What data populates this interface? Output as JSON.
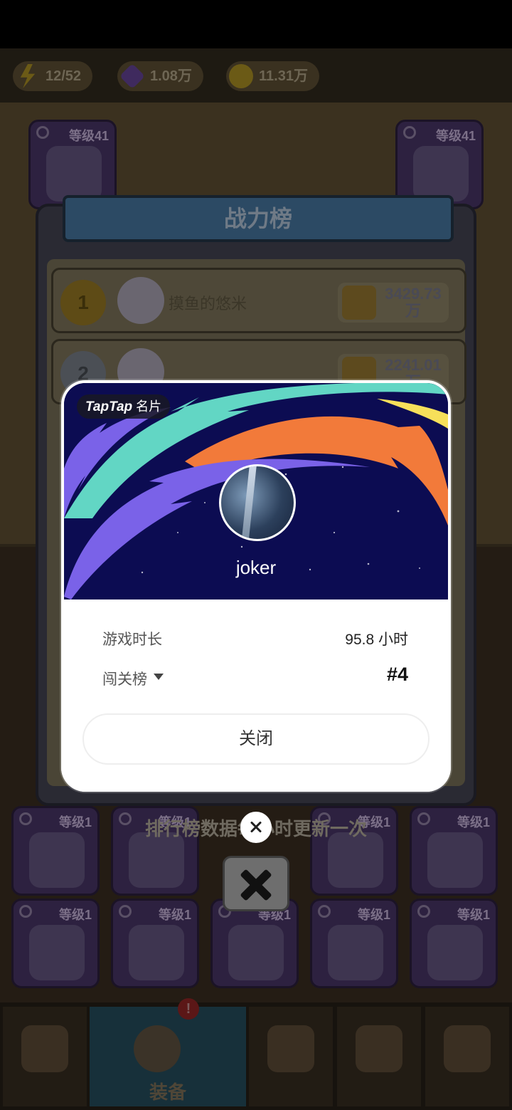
{
  "resources": [
    {
      "icon": "energy-icon",
      "value": "12/52"
    },
    {
      "icon": "gem-icon",
      "value": "1.08万"
    },
    {
      "icon": "coin-icon",
      "value": "11.31万"
    }
  ],
  "equipment_slots": {
    "level_label": "等级41"
  },
  "bottom_slots": {
    "level_label": "等级1"
  },
  "leaderboard": {
    "title": "战力榜",
    "rows": [
      {
        "rank": "1",
        "name": "摸鱼的悠米",
        "power": "3429.73万"
      },
      {
        "rank": "2",
        "name": "",
        "power": "2241.01万"
      }
    ],
    "notice": "排行榜数据每小时更新一次"
  },
  "nav": {
    "tabs": [
      {
        "icon": "shop-icon",
        "label": ""
      },
      {
        "icon": "character-icon",
        "label": "装备",
        "badge": "!"
      },
      {
        "icon": "map-icon",
        "label": ""
      },
      {
        "icon": "quest-icon",
        "label": ""
      },
      {
        "icon": "puzzle-icon",
        "label": ""
      }
    ]
  },
  "card": {
    "brand": "TapTap",
    "brand_suffix": "名片",
    "username": "joker",
    "playtime_label": "游戏时长",
    "playtime_value": "95.8 小时",
    "rank_label": "闯关榜",
    "rank_value": "#4",
    "close_label": "关闭",
    "banner_colors": {
      "bg": "#0c0c52",
      "teal": "#62d6c4",
      "orange": "#f27a3a",
      "purple": "#7a62e8",
      "yellow": "#f7e05a"
    }
  }
}
